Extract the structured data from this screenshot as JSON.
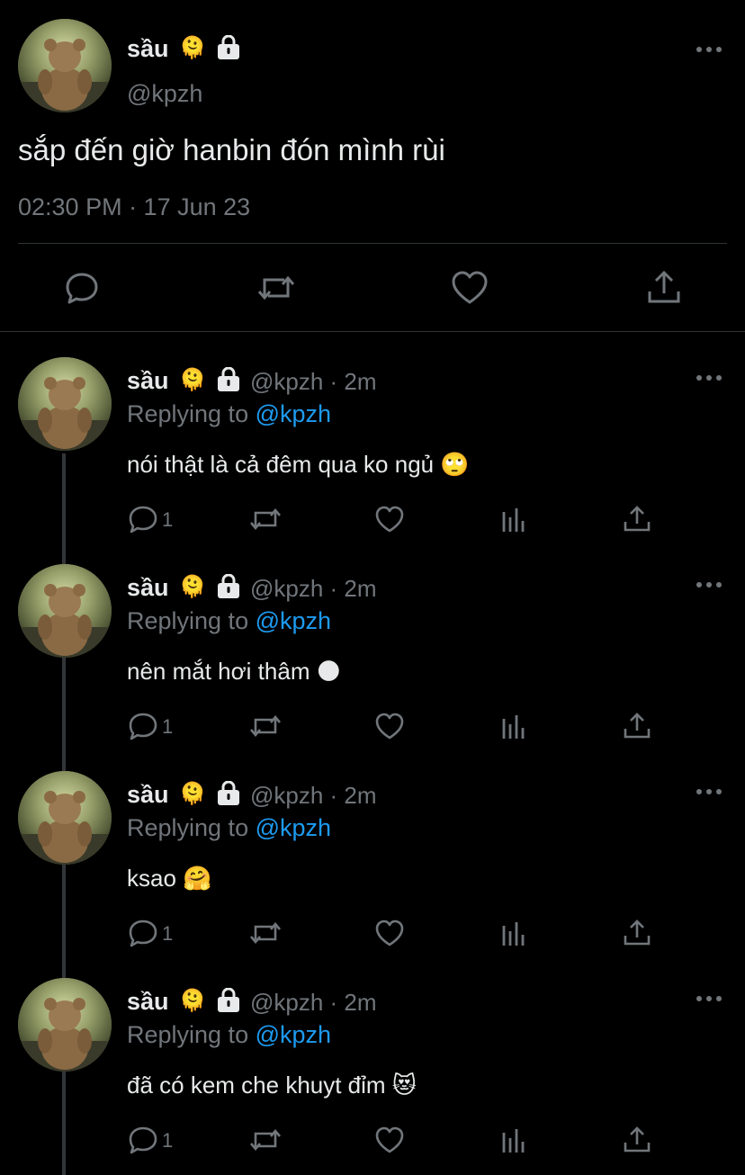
{
  "main_tweet": {
    "name": "sầu",
    "name_emoji": "🫠",
    "handle": "@kpzh",
    "text": "sắp đến giờ hanbin đón mình rùi",
    "timestamp": "02:30 PM · 17 Jun 23"
  },
  "replies": [
    {
      "name": "sầu",
      "name_emoji": "🫠",
      "handle_time": "@kpzh · 2m",
      "replying_prefix": "Replying to ",
      "replying_mention": "@kpzh",
      "text": "nói thật là cả đêm qua ko ngủ 🙄",
      "reply_count": "1"
    },
    {
      "name": "sầu",
      "name_emoji": "🫠",
      "handle_time": "@kpzh · 2m",
      "replying_prefix": "Replying to ",
      "replying_mention": "@kpzh",
      "text": "nên mắt hơi thâm 🌑",
      "reply_count": "1"
    },
    {
      "name": "sầu",
      "name_emoji": "🫠",
      "handle_time": "@kpzh · 2m",
      "replying_prefix": "Replying to ",
      "replying_mention": "@kpzh",
      "text": "ksao 🤗",
      "reply_count": "1"
    },
    {
      "name": "sầu",
      "name_emoji": "🫠",
      "handle_time": "@kpzh · 2m",
      "replying_prefix": "Replying to ",
      "replying_mention": "@kpzh",
      "text": "đã có kem che khuyt đỉm 😻",
      "reply_count": "1"
    }
  ],
  "icons": {
    "more": "more-dots-icon",
    "lock": "lock-icon",
    "reply": "reply-icon",
    "retweet": "retweet-icon",
    "like": "like-icon",
    "views": "analytics-icon",
    "share": "share-icon"
  },
  "colors": {
    "background": "#000000",
    "text": "#e7e9ea",
    "secondary": "#71767b",
    "accent": "#1d9bf0"
  }
}
